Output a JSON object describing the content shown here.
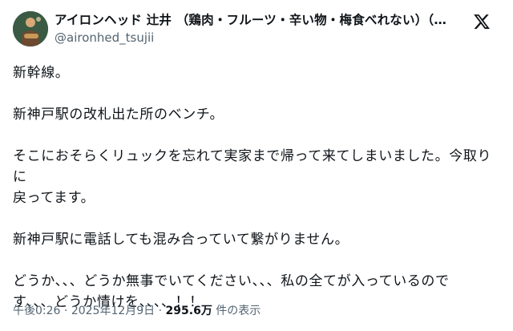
{
  "author": {
    "display_name": "アイロンヘッド 辻井 （鶏肉・フルーツ・辛い物・梅食べれない）（音...",
    "handle": "@aironhed_tsujii",
    "avatar_icon": "profile-photo"
  },
  "header": {
    "brand_icon": "x-logo-icon"
  },
  "tweet": {
    "paragraphs": [
      "新幹線。",
      "新神戸駅の改札出た所のベンチ。",
      "そこにおそらくリュックを忘れて実家まで帰って来てしまいました。今取りに\n戻ってます。",
      "新神戸駅に電話しても混み合っていて繋がりません。",
      "どうか、、、どうか無事でいてください、、、私の全てが入っているので\nす、、、どうか情けを、、、、！！"
    ]
  },
  "meta": {
    "time": "午後0:26",
    "separator": "·",
    "date": "2025年12月9日",
    "views_count": "295.6万",
    "views_label": "件の表示"
  },
  "colors": {
    "text": "#0f1419",
    "secondary": "#536471",
    "background": "#ffffff"
  }
}
